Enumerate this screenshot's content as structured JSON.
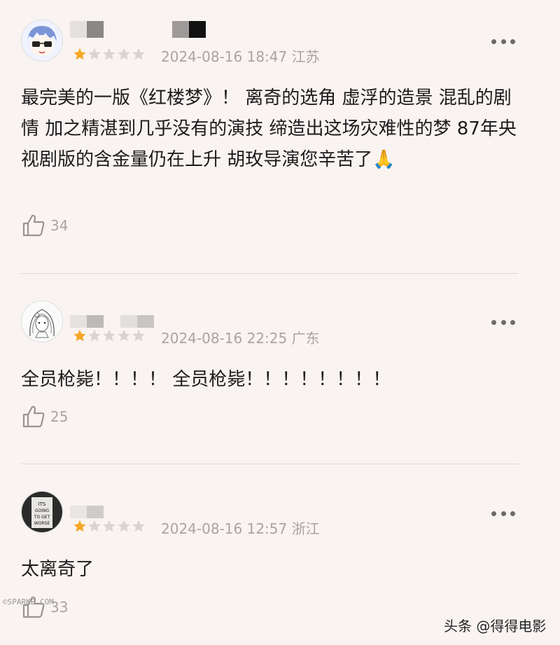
{
  "reviews": [
    {
      "rating": 1,
      "date": "2024-08-16 18:47",
      "region": "江苏",
      "content": "最完美的一版《红楼梦》！ 离奇的选角 虚浮的造景 混乱的剧情 加之精湛到几乎没有的演技 缔造出这场灾难性的梦 87年央视剧版的含金量仍在上升 胡玫导演您辛苦了🙏",
      "likes": "34",
      "avatar": "chibi-glasses-avatar"
    },
    {
      "rating": 1,
      "date": "2024-08-16 22:25",
      "region": "广东",
      "content": "全员枪毙！！！！ 全员枪毙！！！！！！！！",
      "likes": "25",
      "avatar": "sketch-girl-avatar"
    },
    {
      "rating": 1,
      "date": "2024-08-16 12:57",
      "region": "浙江",
      "content": "太离奇了",
      "likes": "33",
      "avatar": "its-going-to-get-worse-avatar",
      "avatar_text": [
        "ITS",
        "GOING",
        "TO GET",
        "WORSE"
      ]
    }
  ],
  "watermark": "头条 @得得电影",
  "corner_mark": "©SPARKE.COM",
  "colors": {
    "star_on": "#f5a623",
    "star_off": "#d9d4d3",
    "meta": "#a8a4a3",
    "background": "#f9f3f1"
  }
}
